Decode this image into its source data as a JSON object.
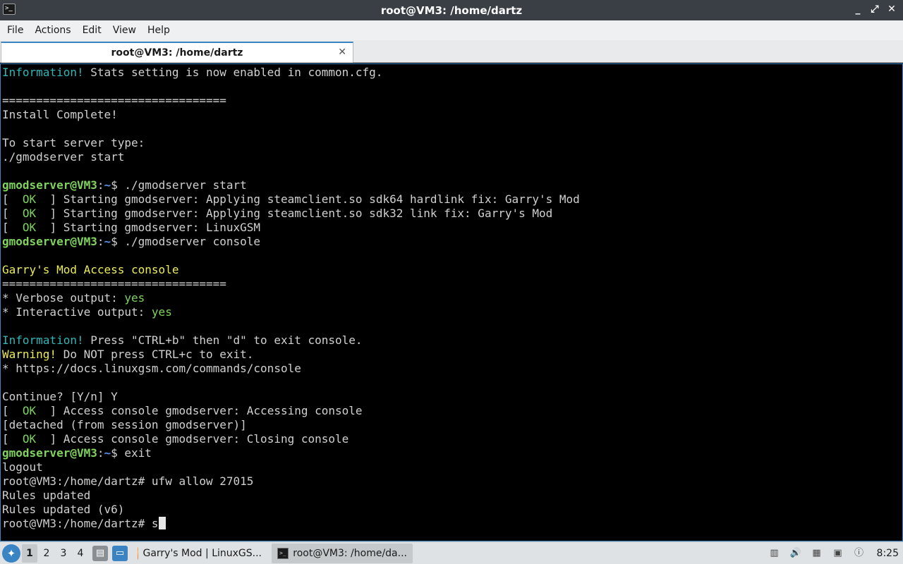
{
  "window": {
    "title": "root@VM3: /home/dartz",
    "controls": [
      "_",
      "⤢",
      "✕"
    ]
  },
  "menubar": {
    "items": [
      "File",
      "Actions",
      "Edit",
      "View",
      "Help"
    ]
  },
  "tabs": [
    {
      "label": "root@VM3: /home/dartz",
      "close": "✕"
    }
  ],
  "terminal": {
    "lines": [
      [
        [
          "Information!",
          "info"
        ],
        [
          " Stats setting is now enabled in common.cfg.",
          "white"
        ]
      ],
      [],
      [
        [
          "=================================",
          "white"
        ]
      ],
      [
        [
          "Install Complete!",
          "white"
        ]
      ],
      [],
      [
        [
          "To start server type:",
          "white"
        ]
      ],
      [
        [
          "./gmodserver start",
          "white"
        ]
      ],
      [],
      [
        [
          "gmodserver@VM3",
          "prompt"
        ],
        [
          ":",
          "white"
        ],
        [
          "~",
          "path"
        ],
        [
          "$ ./gmodserver start",
          "white"
        ]
      ],
      [
        [
          "[  ",
          "white"
        ],
        [
          "OK",
          "green"
        ],
        [
          "  ] Starting gmodserver: Applying steamclient.so sdk64 hardlink fix: Garry's Mod",
          "white"
        ]
      ],
      [
        [
          "[  ",
          "white"
        ],
        [
          "OK",
          "green"
        ],
        [
          "  ] Starting gmodserver: Applying steamclient.so sdk32 link fix: Garry's Mod",
          "white"
        ]
      ],
      [
        [
          "[  ",
          "white"
        ],
        [
          "OK",
          "green"
        ],
        [
          "  ] Starting gmodserver: LinuxGSM",
          "white"
        ]
      ],
      [
        [
          "gmodserver@VM3",
          "prompt"
        ],
        [
          ":",
          "white"
        ],
        [
          "~",
          "path"
        ],
        [
          "$ ./gmodserver console",
          "white"
        ]
      ],
      [],
      [
        [
          "Garry's Mod Access console",
          "yellow"
        ]
      ],
      [
        [
          "=================================",
          "white"
        ]
      ],
      [
        [
          "* Verbose output: ",
          "white"
        ],
        [
          "yes",
          "green"
        ]
      ],
      [
        [
          "* Interactive output: ",
          "white"
        ],
        [
          "yes",
          "green"
        ]
      ],
      [],
      [
        [
          "Information!",
          "info"
        ],
        [
          " Press \"CTRL+b\" then \"d\" to exit console.",
          "white"
        ]
      ],
      [
        [
          "Warning!",
          "yellow"
        ],
        [
          " Do NOT press CTRL+c to exit.",
          "white"
        ]
      ],
      [
        [
          "* https://docs.linuxgsm.com/commands/console",
          "white"
        ]
      ],
      [],
      [
        [
          "Continue? [Y/n] Y",
          "white"
        ]
      ],
      [
        [
          "[  ",
          "white"
        ],
        [
          "OK",
          "green"
        ],
        [
          "  ] Access console gmodserver: Accessing console",
          "white"
        ]
      ],
      [
        [
          "[detached (from session gmodserver)]",
          "white"
        ]
      ],
      [
        [
          "[  ",
          "white"
        ],
        [
          "OK",
          "green"
        ],
        [
          "  ] Access console gmodserver: Closing console",
          "white"
        ]
      ],
      [
        [
          "gmodserver@VM3",
          "prompt"
        ],
        [
          ":",
          "white"
        ],
        [
          "~",
          "path"
        ],
        [
          "$ exit",
          "white"
        ]
      ],
      [
        [
          "logout",
          "white"
        ]
      ],
      [
        [
          "root@VM3:/home/dartz# ufw allow 27015",
          "white"
        ]
      ],
      [
        [
          "Rules updated",
          "white"
        ]
      ],
      [
        [
          "Rules updated (v6)",
          "white"
        ]
      ],
      [
        [
          "root@VM3:/home/dartz# s",
          "white"
        ]
      ]
    ]
  },
  "taskbar": {
    "start_icon": "lxqt-menu-icon",
    "workspaces": [
      "1",
      "2",
      "3",
      "4"
    ],
    "active_workspace": "1",
    "tasks": [
      {
        "label": "Garry's Mod | LinuxGS...",
        "icon": "firefox-icon"
      },
      {
        "label": "root@VM3: /home/da...",
        "icon": "terminal-icon"
      }
    ],
    "clock": "8:25"
  },
  "colors": {
    "info": "#2fb5b5",
    "ok_green": "#7fd35d",
    "warning_yellow": "#ecec5a",
    "prompt_path_blue": "#5b8fe6",
    "accent": "#3b84c4"
  }
}
